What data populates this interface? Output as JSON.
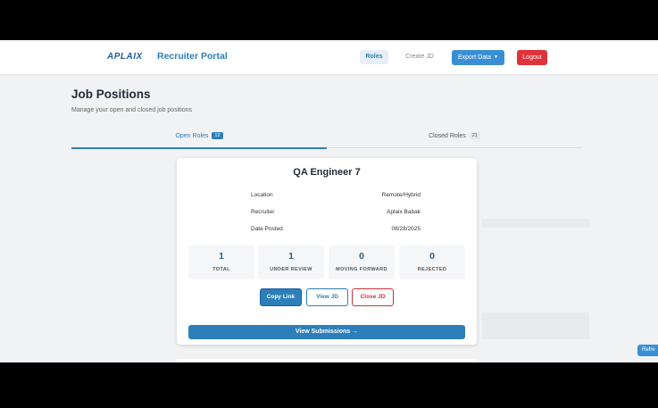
{
  "header": {
    "logo": "APLAIX",
    "app_title": "Recruiter Portal",
    "nav": {
      "roles": "Roles",
      "create_jd": "Create JD"
    },
    "export_label": "Export Data",
    "logout_label": "Logout"
  },
  "page": {
    "title": "Job Positions",
    "subtitle": "Manage your open and closed job positions"
  },
  "tabs": [
    {
      "label": "Open Roles",
      "count": "12"
    },
    {
      "label": "Closed Roles",
      "count": "21"
    }
  ],
  "job": {
    "title": "QA Engineer 7",
    "details": [
      {
        "label": "Location",
        "value": "Remote/Hybrid"
      },
      {
        "label": "Recruiter",
        "value": "Aplaix Babak"
      },
      {
        "label": "Date Posted",
        "value": "08/28/2025"
      }
    ],
    "stats": [
      {
        "value": "1",
        "label": "TOTAL"
      },
      {
        "value": "1",
        "label": "UNDER REVIEW"
      },
      {
        "value": "0",
        "label": "MOVING FORWARD"
      },
      {
        "value": "0",
        "label": "REJECTED"
      }
    ],
    "actions": {
      "copy_link": "Copy Link",
      "view_jd": "View JD",
      "close_jd": "Close JD"
    },
    "view_submissions": "View Submissions →"
  },
  "refresh_label": "Refre",
  "colors": {
    "accent": "#2c7fb8",
    "danger": "#e0323a"
  }
}
